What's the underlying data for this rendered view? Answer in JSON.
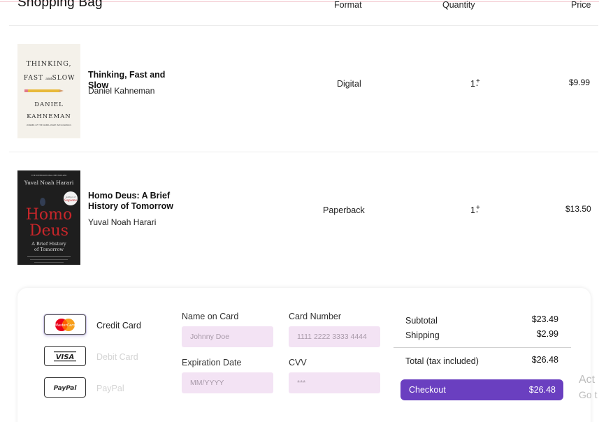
{
  "bag": {
    "title": "Shopping Bag"
  },
  "columns": {
    "format": "Format",
    "quantity": "Quantity",
    "price": "Price"
  },
  "items": [
    {
      "title": "Thinking, Fast and Slow",
      "author": "Daniel Kahneman",
      "format": "Digital",
      "quantity": "1",
      "price": "$9.99",
      "cover": {
        "line1": "THINKING,",
        "line2": "FAST",
        "line2b": "and",
        "line2c": "SLOW",
        "author1": "DANIEL",
        "author2": "KAHNEMAN",
        "tagline": "WINNER OF THE NOBEL PRIZE IN ECONOMICS"
      }
    },
    {
      "title": "Homo Deus: A Brief History of Tomorrow",
      "author": "Yuval Noah Harari",
      "format": "Paperback",
      "quantity": "1",
      "price": "$13.50",
      "cover": {
        "top": "THE INTERNATIONAL BESTSELLER",
        "author": "Yuval Noah Harari",
        "t1": "Homo",
        "t2": "Deus",
        "sub1": "A Brief History",
        "sub2": "of Tomorrow",
        "badge1": "Author of",
        "badge2": "Sapiens"
      }
    }
  ],
  "payment": {
    "methods": [
      {
        "label": "Credit Card",
        "logo": "MasterCard",
        "icon": "mastercard-icon"
      },
      {
        "label": "Debit Card",
        "logo": "VISA",
        "icon": "visa-icon"
      },
      {
        "label": "PayPal",
        "logo": "PayPal",
        "icon": "paypal-icon"
      }
    ],
    "fields": {
      "name_label": "Name on Card",
      "name_placeholder": "Johnny Doe",
      "number_label": "Card Number",
      "number_placeholder": "1111 2222 3333 4444",
      "exp_label": "Expiration Date",
      "exp_placeholder": "MM/YYYY",
      "cvv_label": "CVV",
      "cvv_placeholder": "***"
    }
  },
  "summary": {
    "subtotal_label": "Subtotal",
    "subtotal": "$23.49",
    "shipping_label": "Shipping",
    "shipping": "$2.99",
    "total_label": "Total (tax included)",
    "total": "$26.48",
    "checkout_label": "Checkout",
    "checkout_amount": "$26.48"
  },
  "watermark": {
    "line1": "Act",
    "line2": "Go t"
  },
  "colors": {
    "accent": "#6a3fc0",
    "input_bg": "#f3e3f4",
    "mastercard_red": "#eb001b",
    "mastercard_orange": "#f79e1b",
    "homo_deus_red": "#c8262a"
  }
}
